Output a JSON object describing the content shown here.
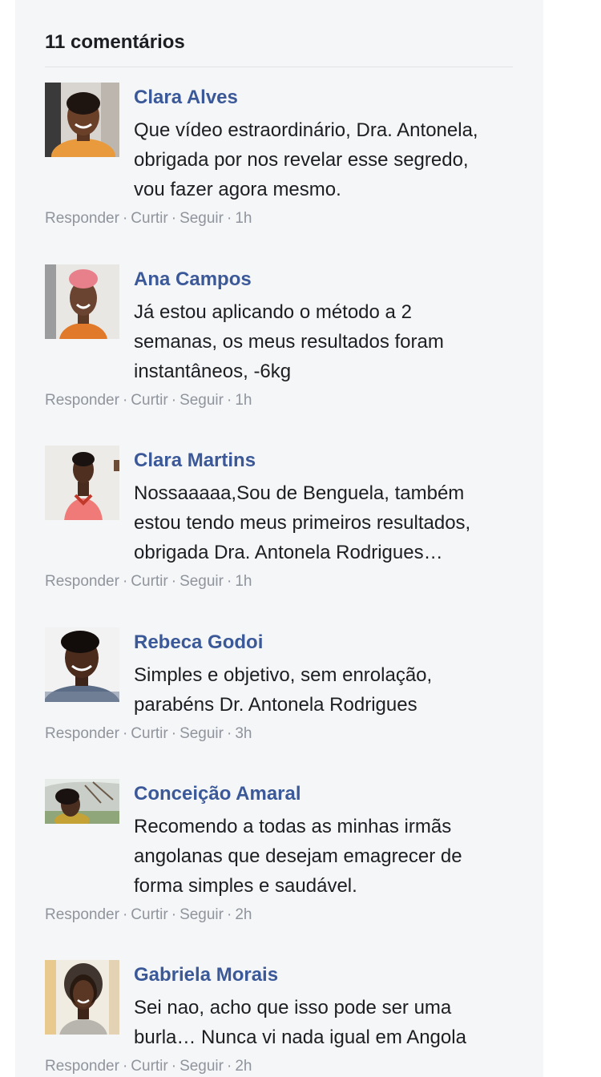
{
  "header": {
    "title": "11 comentários"
  },
  "actions_labels": {
    "reply": "Responder",
    "like": "Curtir",
    "follow": "Seguir",
    "separator": "·"
  },
  "comments": [
    {
      "author": "Clara Alves",
      "lines": [
        "Que vídeo estraordinário, Dra. Antonela,",
        "obrigada por nos revelar esse segredo,",
        "vou fazer agora mesmo."
      ],
      "time": "1h"
    },
    {
      "author": "Ana Campos",
      "lines": [
        "Já estou aplicando o método a 2",
        "semanas, os meus resultados foram",
        "instantâneos, -6kg"
      ],
      "time": "1h"
    },
    {
      "author": "Clara Martins",
      "lines": [
        "Nossaaaaa,Sou de Benguela, também",
        "estou tendo meus primeiros resultados,",
        "obrigada Dra. Antonela Rodrigues…"
      ],
      "time": "1h"
    },
    {
      "author": "Rebeca Godoi",
      "lines": [
        "Simples e objetivo, sem enrolação,",
        "parabéns Dr. Antonela Rodrigues"
      ],
      "time": "3h"
    },
    {
      "author": "Conceição Amaral",
      "lines": [
        "Recomendo a todas as minhas irmãs",
        "angolanas que desejam emagrecer de",
        "forma simples e saudável."
      ],
      "time": "2h"
    },
    {
      "author": "Gabriela Morais",
      "lines": [
        "Sei nao, acho que isso pode ser uma",
        "burla… Nunca vi nada igual em Angola"
      ],
      "time": "2h"
    }
  ]
}
